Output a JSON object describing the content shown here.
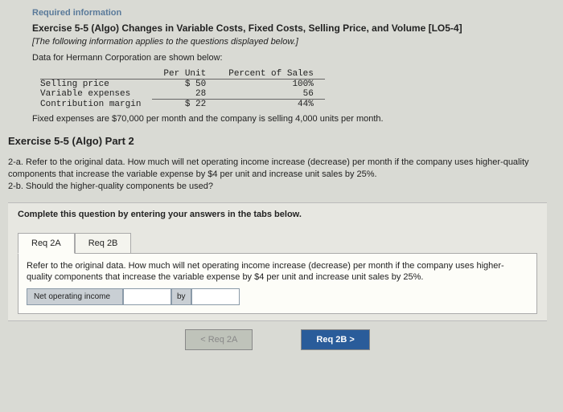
{
  "header": {
    "required": "Required information",
    "title": "Exercise 5-5 (Algo) Changes in Variable Costs, Fixed Costs, Selling Price, and Volume [LO5-4]",
    "note": "[The following information applies to the questions displayed below.]",
    "data_intro": "Data for Hermann Corporation are shown below:"
  },
  "table": {
    "h1": "Per Unit",
    "h2": "Percent of Sales",
    "rows": [
      {
        "label": "Selling price",
        "unit": "$ 50",
        "pct": "100%"
      },
      {
        "label": "Variable expenses",
        "unit": "28",
        "pct": "56"
      },
      {
        "label": "Contribution margin",
        "unit": "$ 22",
        "pct": "44%"
      }
    ]
  },
  "fixed": "Fixed expenses are $70,000 per month and the company is selling 4,000 units per month.",
  "part": {
    "title": "Exercise 5-5 (Algo) Part 2",
    "q": "2-a. Refer to the original data. How much will net operating income increase (decrease) per month if the company uses higher-quality components that increase the variable expense by $4 per unit and increase unit sales by 25%.\n2-b. Should the higher-quality components be used?"
  },
  "answer": {
    "complete": "Complete this question by entering your answers in the tabs below.",
    "tabs": [
      {
        "label": "Req 2A"
      },
      {
        "label": "Req 2B"
      }
    ],
    "panel_text": "Refer to the original data. How much will net operating income increase (decrease) per month if the company uses higher-quality components that increase the variable expense by $4 per unit and increase unit sales by 25%.",
    "row_label": "Net operating income",
    "by": "by"
  },
  "nav": {
    "prev": "<  Req 2A",
    "next": "Req 2B  >"
  }
}
